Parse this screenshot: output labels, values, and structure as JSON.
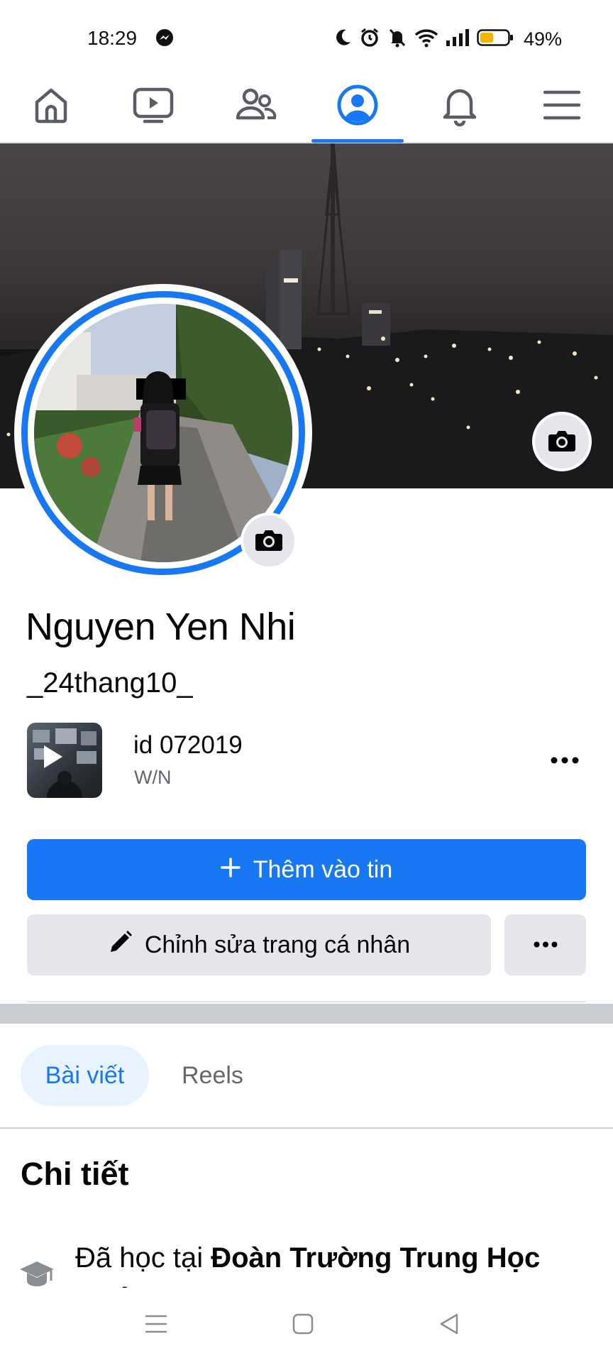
{
  "status_bar": {
    "time": "18:29",
    "battery_percent": "49%",
    "battery_level": 0.49,
    "icons": [
      "messenger-icon",
      "moon-icon",
      "alarm-icon",
      "mute-icon",
      "wifi-icon",
      "signal-icon",
      "battery-icon"
    ]
  },
  "top_nav": {
    "items": [
      "home-icon",
      "video-icon",
      "friends-icon",
      "profile-icon",
      "bell-icon",
      "menu-icon"
    ],
    "active_index": 3
  },
  "profile": {
    "name": "Nguyen Yen Nhi",
    "username": "_24thang10_"
  },
  "featured": {
    "title": "id 072019",
    "subtitle": "W/N"
  },
  "actions": {
    "add_story": "Thêm vào tin",
    "edit_profile": "Chỉnh sửa trang cá nhân"
  },
  "tabs": [
    {
      "label": "Bài viết",
      "active": true
    },
    {
      "label": "Reels",
      "active": false
    }
  ],
  "details": {
    "heading": "Chi tiết",
    "education_prefix": "Đã học tại ",
    "education_school": "Đoàn Trường Trung Học Phổ Thông Tiền Văn Gi..."
  },
  "colors": {
    "accent": "#1877f2",
    "button_gray": "#e4e6eb",
    "text_secondary": "#65676b"
  }
}
